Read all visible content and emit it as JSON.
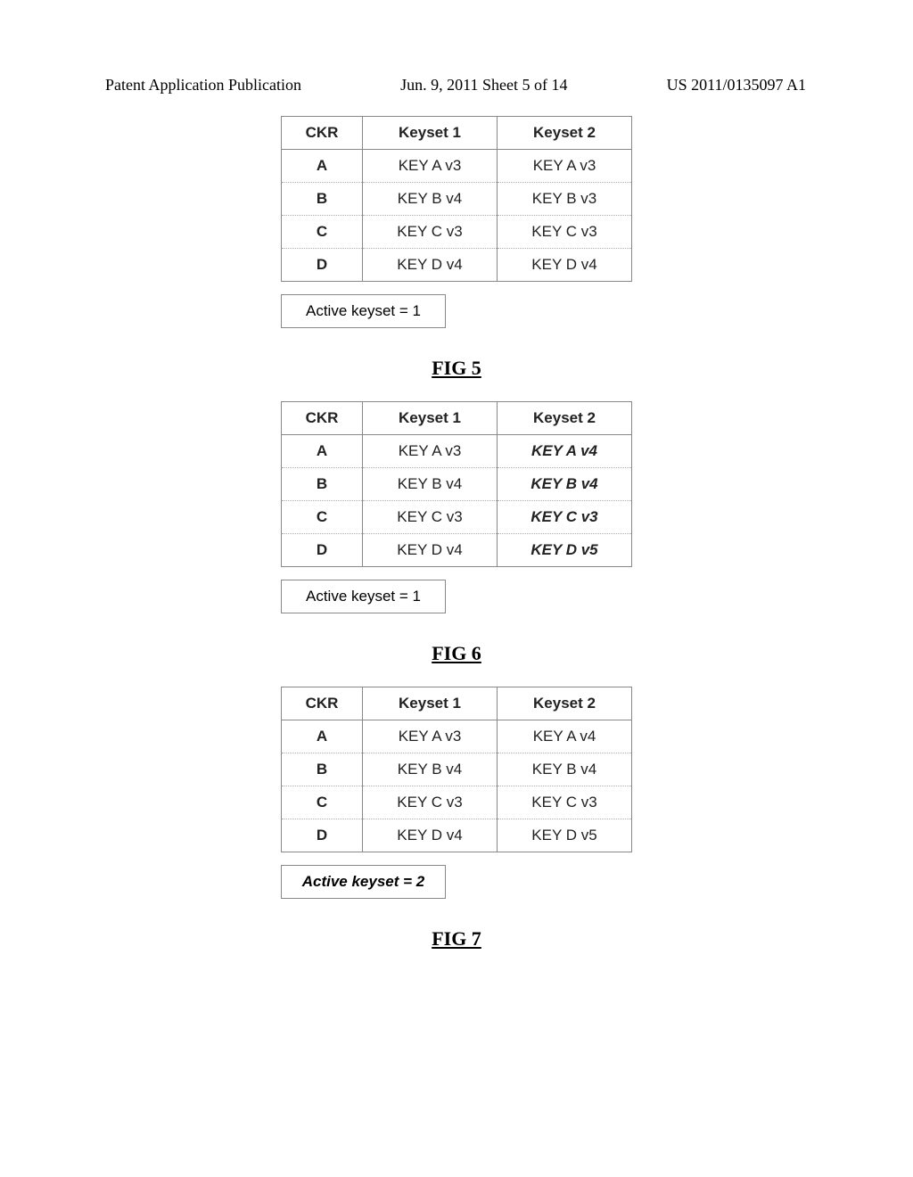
{
  "header": {
    "left": "Patent Application Publication",
    "center": "Jun. 9, 2011  Sheet 5 of 14",
    "right": "US 2011/0135097 A1"
  },
  "figures": [
    {
      "caption": "FIG 5",
      "active_keyset": "Active keyset = 1",
      "active_emph": false,
      "headers": [
        "CKR",
        "Keyset 1",
        "Keyset 2"
      ],
      "rows": [
        {
          "ckr": "A",
          "k1": "KEY A v3",
          "k2": "KEY A v3",
          "k2_emph": false
        },
        {
          "ckr": "B",
          "k1": "KEY B v4",
          "k2": "KEY B v3",
          "k2_emph": false
        },
        {
          "ckr": "C",
          "k1": "KEY C v3",
          "k2": "KEY C v3",
          "k2_emph": false
        },
        {
          "ckr": "D",
          "k1": "KEY D v4",
          "k2": "KEY D v4",
          "k2_emph": false
        }
      ]
    },
    {
      "caption": "FIG 6",
      "active_keyset": "Active keyset = 1",
      "active_emph": false,
      "headers": [
        "CKR",
        "Keyset 1",
        "Keyset 2"
      ],
      "rows": [
        {
          "ckr": "A",
          "k1": "KEY A v3",
          "k2": "KEY A v4",
          "k2_emph": true
        },
        {
          "ckr": "B",
          "k1": "KEY B v4",
          "k2": "KEY B v4",
          "k2_emph": true
        },
        {
          "ckr": "C",
          "k1": "KEY C v3",
          "k2": "KEY C v3",
          "k2_emph": true
        },
        {
          "ckr": "D",
          "k1": "KEY D v4",
          "k2": "KEY D v5",
          "k2_emph": true
        }
      ]
    },
    {
      "caption": "FIG 7",
      "active_keyset": "Active keyset = 2",
      "active_emph": true,
      "headers": [
        "CKR",
        "Keyset 1",
        "Keyset 2"
      ],
      "rows": [
        {
          "ckr": "A",
          "k1": "KEY A v3",
          "k2": "KEY A v4",
          "k2_emph": false
        },
        {
          "ckr": "B",
          "k1": "KEY B v4",
          "k2": "KEY B v4",
          "k2_emph": false
        },
        {
          "ckr": "C",
          "k1": "KEY C v3",
          "k2": "KEY C v3",
          "k2_emph": false
        },
        {
          "ckr": "D",
          "k1": "KEY D v4",
          "k2": "KEY D v5",
          "k2_emph": false
        }
      ]
    }
  ]
}
